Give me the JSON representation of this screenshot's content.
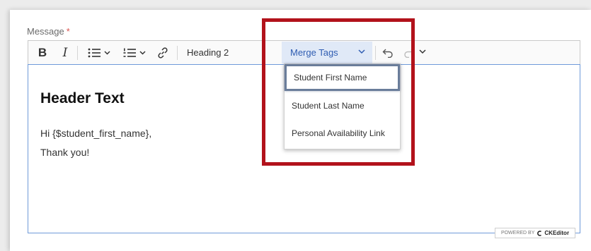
{
  "field": {
    "label": "Message",
    "required_marker": "*"
  },
  "toolbar": {
    "bold": "B",
    "italic": "I",
    "heading_value": "Heading 2",
    "merge_label": "Merge Tags"
  },
  "editor": {
    "heading": "Header Text",
    "line1": "Hi {$student_first_name},",
    "line2": "Thank you!"
  },
  "merge_menu": {
    "items": [
      {
        "label": "Student First Name",
        "selected": true
      },
      {
        "label": "Student Last Name",
        "selected": false
      },
      {
        "label": "Personal Availability Link",
        "selected": false
      }
    ]
  },
  "powered_by": {
    "prefix": "POWERED BY",
    "brand": "CKEditor"
  },
  "colors": {
    "highlight_border": "#b2121b",
    "merge_button_bg": "#e0e9f7",
    "merge_button_text": "#2f5db2",
    "editor_focus_border": "#6f9ad9"
  },
  "icons": [
    "bulleted-list-icon",
    "numbered-list-icon",
    "link-icon",
    "undo-icon",
    "redo-icon",
    "chevron-down-icon",
    "ckeditor-logo-icon"
  ]
}
